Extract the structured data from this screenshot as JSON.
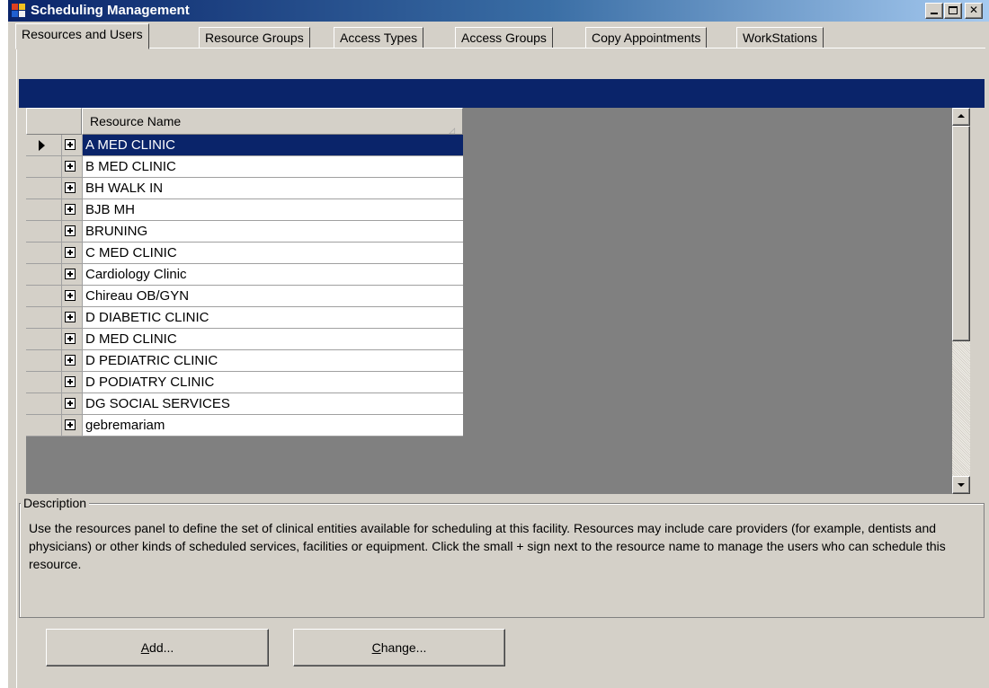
{
  "window": {
    "title": "Scheduling Management",
    "controls": {
      "minimize": "minimize",
      "maximize": "maximize",
      "close": "close"
    }
  },
  "tabs": [
    {
      "label": "Resources and Users",
      "active": true
    },
    {
      "label": "Resource Groups",
      "active": false
    },
    {
      "label": "Access Types",
      "active": false
    },
    {
      "label": "Access Groups",
      "active": false
    },
    {
      "label": "Copy Appointments",
      "active": false
    },
    {
      "label": "WorkStations",
      "active": false
    }
  ],
  "grid": {
    "column_header": "Resource Name",
    "selected_index": 0,
    "rows": [
      "A MED CLINIC",
      "B MED CLINIC",
      "BH WALK IN",
      "BJB MH",
      "BRUNING",
      "C MED CLINIC",
      "Cardiology Clinic",
      "Chireau OB/GYN",
      "D DIABETIC CLINIC",
      "D MED CLINIC",
      "D PEDIATRIC CLINIC",
      "D PODIATRY CLINIC",
      "DG SOCIAL SERVICES",
      "gebremariam"
    ]
  },
  "description": {
    "legend": "Description",
    "text": "Use the resources panel to define the set of clinical entities available for scheduling at this facility.  Resources may include care providers (for example, dentists and physicians) or other kinds of scheduled services, facilities or equipment.  Click the small + sign next to the resource name to manage the users who can schedule this resource."
  },
  "buttons": {
    "add": {
      "mnemonic": "A",
      "rest": "dd..."
    },
    "change": {
      "mnemonic": "C",
      "rest": "hange..."
    }
  },
  "colors": {
    "titlebar_start": "#0a246a",
    "titlebar_end": "#a6caf0",
    "selection": "#0a246a",
    "face": "#d4d0c8",
    "grid_bg": "#808080"
  }
}
